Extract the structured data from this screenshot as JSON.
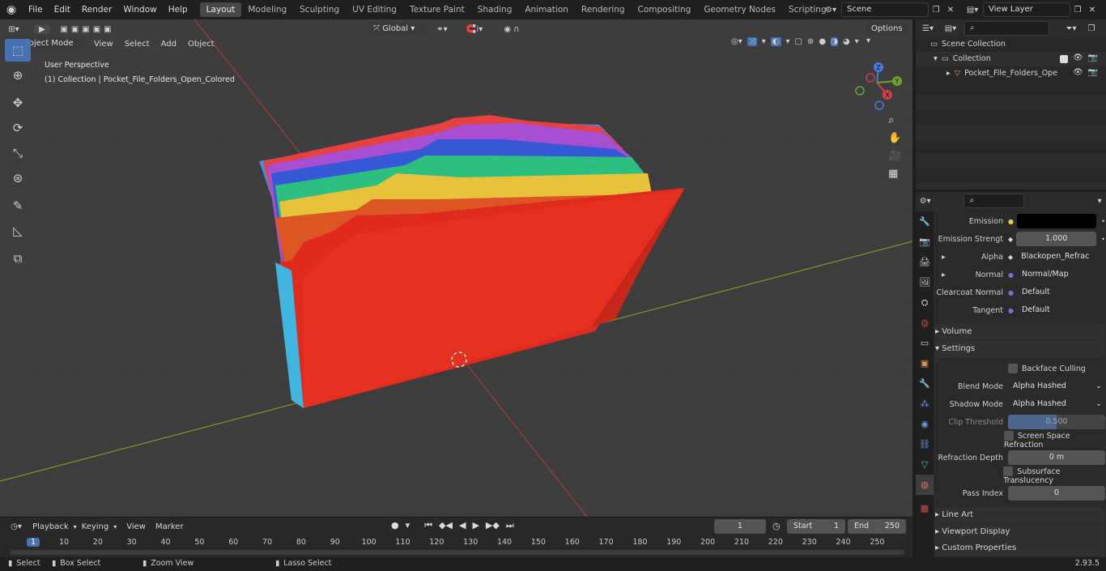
{
  "app": {
    "logo": "blender-icon",
    "menu": [
      "File",
      "Edit",
      "Render",
      "Window",
      "Help"
    ],
    "workspaces": [
      "Layout",
      "Modeling",
      "Sculpting",
      "UV Editing",
      "Texture Paint",
      "Shading",
      "Animation",
      "Rendering",
      "Compositing",
      "Geometry Nodes",
      "Scripting"
    ],
    "active_workspace": "Layout",
    "scene": "Scene",
    "view_layer": "View Layer"
  },
  "viewport": {
    "mode": "Object Mode",
    "menus": [
      "View",
      "Select",
      "Add",
      "Object"
    ],
    "orientation": "Global",
    "options": "Options",
    "perspective": "User Perspective",
    "collection_info": "(1) Collection | Pocket_File_Folders_Open_Colored",
    "gizmo_axes": {
      "x": "X",
      "y": "Y",
      "z": "Z"
    },
    "folder_colors": [
      "#e02a1c",
      "#de5524",
      "#e8c23a",
      "#2dbf80",
      "#3559d6",
      "#a84fd1",
      "#e64040"
    ]
  },
  "outliner": {
    "root": "Scene Collection",
    "collection": "Collection",
    "object": "Pocket_File_Folders_Ope"
  },
  "properties": {
    "emission_label": "Emission",
    "emission_strength_label": "Emission Strengt",
    "emission_strength": "1.000",
    "alpha_label": "Alpha",
    "alpha_value": "Blackopen_Refracti...",
    "normal_label": "Normal",
    "normal_value": "Normal/Map",
    "clearcoat_label": "Clearcoat Normal",
    "clearcoat_value": "Default",
    "tangent_label": "Tangent",
    "tangent_value": "Default",
    "volume": "Volume",
    "settings": "Settings",
    "backface": "Backface Culling",
    "blend_label": "Blend Mode",
    "blend_value": "Alpha Hashed",
    "shadow_label": "Shadow Mode",
    "shadow_value": "Alpha Hashed",
    "clip_label": "Clip Threshold",
    "clip_value": "0.500",
    "ssr": "Screen Space Refraction",
    "refraction_label": "Refraction Depth",
    "refraction_value": "0 m",
    "subsurface": "Subsurface Translucency",
    "pass_label": "Pass Index",
    "pass_value": "0",
    "line_art": "Line Art",
    "viewport_display": "Viewport Display",
    "custom_props": "Custom Properties"
  },
  "timeline": {
    "menus": [
      "Playback",
      "Keying",
      "View",
      "Marker"
    ],
    "current_frame": "1",
    "start_label": "Start",
    "start": "1",
    "end_label": "End",
    "end": "250",
    "ruler": [
      "1",
      "10",
      "20",
      "30",
      "40",
      "50",
      "60",
      "70",
      "80",
      "90",
      "100",
      "110",
      "120",
      "130",
      "140",
      "150",
      "160",
      "170",
      "180",
      "190",
      "200",
      "210",
      "220",
      "230",
      "240",
      "250"
    ]
  },
  "status": {
    "select": "Select",
    "box_select": "Box Select",
    "zoom_view": "Zoom View",
    "lasso_select": "Lasso Select",
    "version": "2.93.5"
  }
}
